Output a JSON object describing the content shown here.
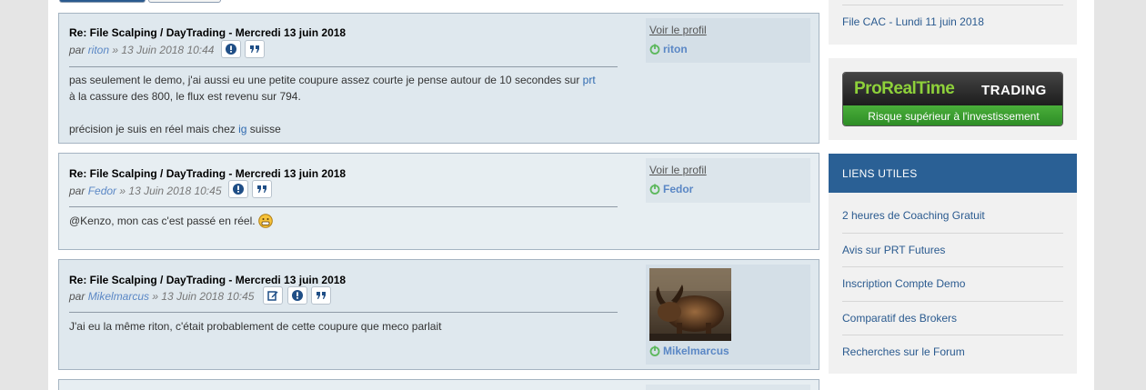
{
  "posts": [
    {
      "title": "Re: File Scalping / DayTrading - Mercredi 13 juin 2018",
      "by": "par",
      "author": "riton",
      "date": "» 13 Juin 2018 10:44",
      "body_line1_pre": "pas seulement le demo, j'ai aussi eu une petite coupure assez courte je pense autour de 10 secondes sur ",
      "body_line1_link": "prt",
      "body_line2": "à la cassure des 800, le flux est revenu sur 794.",
      "body_line3_pre": "précision je suis en réel mais chez ",
      "body_line3_link": "ig",
      "body_line3_post": " suisse",
      "profile_link": "Voir le profil",
      "profile_user": "riton"
    },
    {
      "title": "Re: File Scalping / DayTrading - Mercredi 13 juin 2018",
      "by": "par",
      "author": "Fedor",
      "date": "» 13 Juin 2018 10:45",
      "body": "@Kenzo, mon cas c'est passé en réel.",
      "profile_link": "Voir le profil",
      "profile_user": "Fedor"
    },
    {
      "title": "Re: File Scalping / DayTrading - Mercredi 13 juin 2018",
      "by": "par",
      "author": "Mikelmarcus",
      "date": "» 13 Juin 2018 10:45",
      "body": "J'ai eu la même riton, c'était probablement de cette coupure que meco parlait",
      "profile_user": "Mikelmarcus"
    }
  ],
  "sidebar": {
    "top_link": "File CAC - Lundi 11 juin 2018",
    "banner": {
      "brand": "ProRealTime",
      "brand_suffix": "TRADING",
      "tagline": "Risque supérieur à l'investissement"
    },
    "useful_links_title": "LIENS UTILES",
    "useful_links": [
      "2 heures de Coaching Gratuit",
      "Avis sur PRT Futures",
      "Inscription Compte Demo",
      "Comparatif des Brokers",
      "Recherches sur le Forum"
    ]
  },
  "colors": {
    "accent": "#2a6095",
    "link": "#5a87c5",
    "online": "#5cb85c",
    "post_bg": "#dfe8ee"
  },
  "icons": [
    "report-icon",
    "quote-icon",
    "edit-icon",
    "online-status-icon",
    "emoji-grin-icon"
  ]
}
